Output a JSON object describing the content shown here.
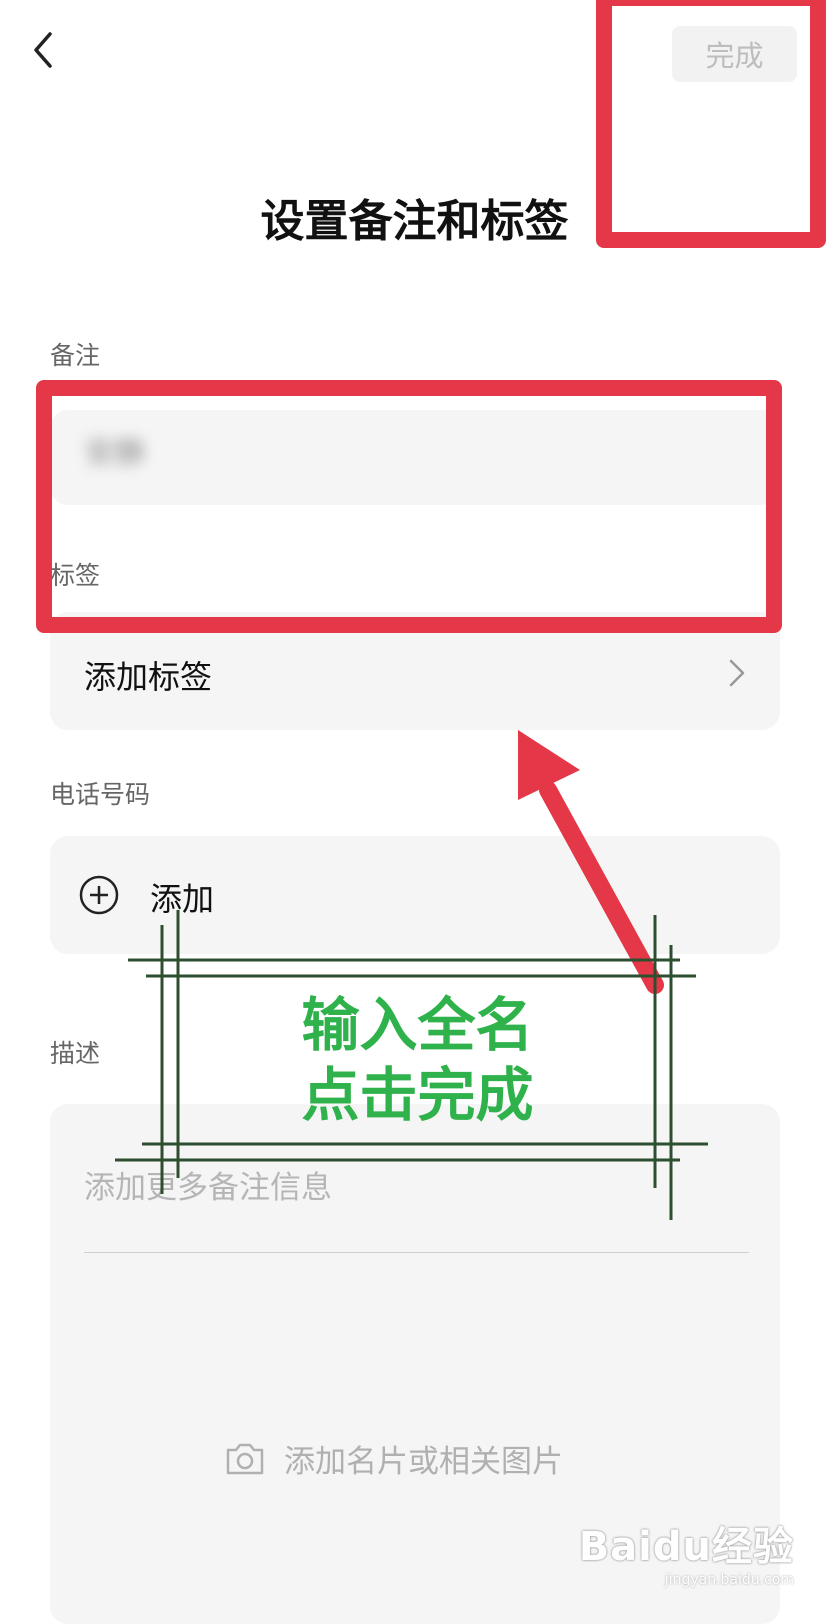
{
  "header": {
    "done_label": "完成"
  },
  "page_title": "设置备注和标签",
  "remark": {
    "label": "备注",
    "value": "安静"
  },
  "tags": {
    "label": "标签",
    "add_label": "添加标签"
  },
  "phone": {
    "label": "电话号码",
    "add_label": "添加"
  },
  "description": {
    "label": "描述",
    "placeholder": "添加更多备注信息",
    "photo_label": "添加名片或相关图片"
  },
  "annotation": {
    "line1": "输入全名",
    "line2": "点击完成"
  },
  "watermark": {
    "brand": "Baidu经验",
    "url": "jingyan.baidu.com"
  },
  "colors": {
    "highlight_red": "#e43747",
    "annotation_green": "#2fb24b",
    "frame_dark_green": "#2d4f2f"
  },
  "icons": [
    "chevron-left-icon",
    "chevron-right-icon",
    "plus-circle-icon",
    "camera-icon"
  ]
}
